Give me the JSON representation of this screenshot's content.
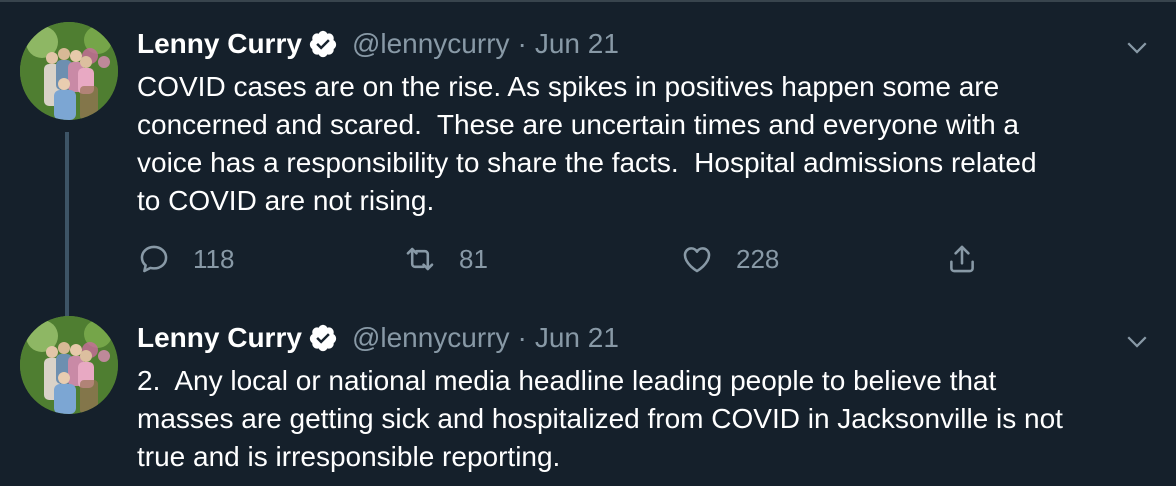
{
  "tweets": [
    {
      "author_name": "Lenny Curry",
      "handle": "@lennycurry",
      "separator": "·",
      "date": "Jun 21",
      "text": "COVID cases are on the rise. As spikes in positives happen some are\nconcerned and scared.  These are uncertain times and everyone with a\nvoice has a responsibility to share the facts.  Hospital admissions related\nto COVID are not rising.",
      "reply_count": "118",
      "retweet_count": "81",
      "like_count": "228"
    },
    {
      "author_name": "Lenny Curry",
      "handle": "@lennycurry",
      "separator": "·",
      "date": "Jun 21",
      "text": "2.  Any local or national media headline leading people to believe that\nmasses are getting sick and hospitalized from COVID in Jacksonville is not\ntrue and is irresponsible reporting."
    }
  ],
  "icons": {
    "verified": "verified-badge-icon",
    "caret": "chevron-down-icon",
    "reply": "reply-icon",
    "retweet": "retweet-icon",
    "like": "heart-icon",
    "share": "share-icon"
  },
  "colors": {
    "background": "#15202b",
    "secondary_text": "#8899a6",
    "thread_line": "#3d5466",
    "verified": "#ffffff"
  }
}
